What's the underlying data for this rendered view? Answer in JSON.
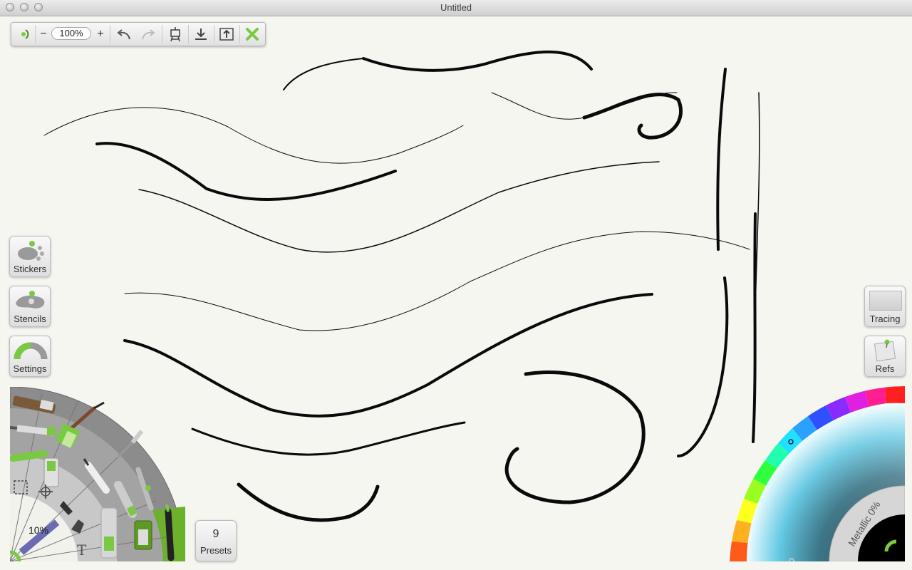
{
  "window": {
    "title": "Untitled"
  },
  "toolbar": {
    "zoom_value": "100%",
    "zoom_out_label": "−",
    "zoom_in_label": "+",
    "icons": [
      "menu-icon",
      "zoom-out-icon",
      "zoom-in-icon",
      "undo-icon",
      "redo-icon",
      "easel-icon",
      "import-icon",
      "export-icon",
      "close-icon"
    ]
  },
  "side_tools": {
    "stickers": "Stickers",
    "stencils": "Stencils",
    "settings": "Settings"
  },
  "wheel": {
    "brush_size": "10%",
    "text_tool_glyph": "T",
    "tools": [
      "paint-brush",
      "watercolor-brush",
      "pencil",
      "paint-tube",
      "pastel",
      "marker",
      "felt-tip",
      "palette-knife",
      "airbrush",
      "ink-pen",
      "gloop-pen",
      "paint-roller",
      "eraser",
      "fill",
      "text"
    ]
  },
  "presets": {
    "count": "9",
    "label": "Presets"
  },
  "right_tools": {
    "tracing": "Tracing",
    "refs": "Refs"
  },
  "color": {
    "metallic_label": "Metallic 0%",
    "current_color": "#000000",
    "accent": "#7ac943"
  }
}
